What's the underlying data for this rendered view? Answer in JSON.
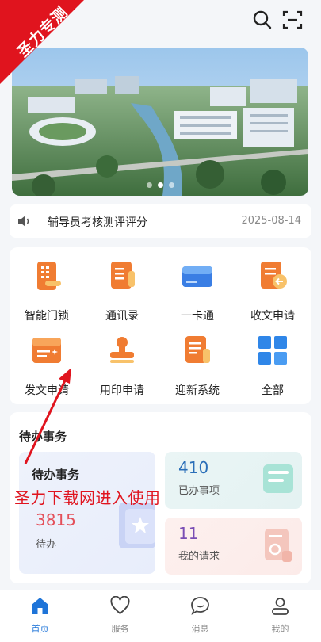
{
  "watermark": {
    "corner": "圣力专测",
    "caption": "圣力下载网进入使用"
  },
  "banner": {
    "slides": 3,
    "active_slide": 2
  },
  "notice": {
    "title": "辅导员考核测评评分",
    "date": "2025-08-14"
  },
  "apps": [
    {
      "label": "智能门锁",
      "icon": "smart-lock-icon"
    },
    {
      "label": "通讯录",
      "icon": "contacts-icon"
    },
    {
      "label": "一卡通",
      "icon": "campus-card-icon"
    },
    {
      "label": "收文申请",
      "icon": "receive-doc-icon"
    },
    {
      "label": "发文申请",
      "icon": "send-doc-icon"
    },
    {
      "label": "用印申请",
      "icon": "seal-icon"
    },
    {
      "label": "迎新系统",
      "icon": "welcome-system-icon"
    },
    {
      "label": "全部",
      "icon": "grid-all-icon"
    }
  ],
  "todo": {
    "section_title": "待办事务",
    "main": {
      "label": "待办事务",
      "count": "3815",
      "sub": "待办"
    },
    "done": {
      "count": "410",
      "sub": "已办事项"
    },
    "requests": {
      "count": "11",
      "sub": "我的请求"
    }
  },
  "tabbar": [
    {
      "label": "首页",
      "icon": "home-icon",
      "active": true
    },
    {
      "label": "服务",
      "icon": "heart-icon",
      "active": false
    },
    {
      "label": "消息",
      "icon": "chat-bubble-icon",
      "active": false
    },
    {
      "label": "我的",
      "icon": "user-icon",
      "active": false
    }
  ],
  "colors": {
    "accent": "#1e74d8",
    "watermark": "#e0141e",
    "app_orange": "#f07c32"
  }
}
